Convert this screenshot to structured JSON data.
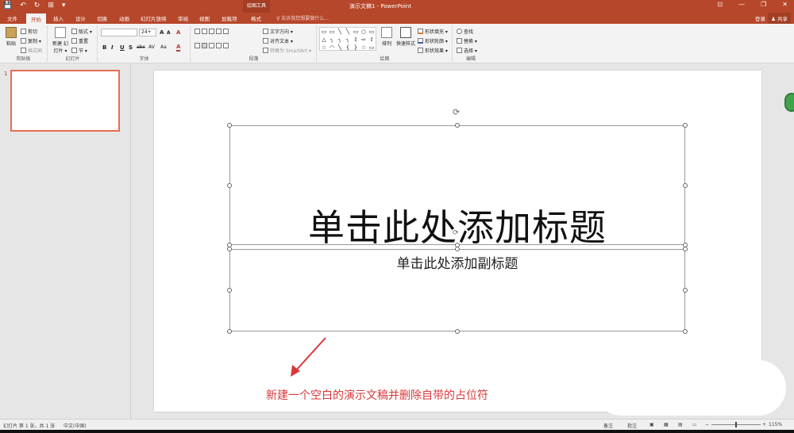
{
  "app": {
    "title": "演示文稿1 - PowerPoint",
    "context_tab_group": "绘图工具",
    "qat": [
      "💾",
      "↶",
      "↻",
      "⊞",
      "▾"
    ],
    "window_buttons": [
      "⊡",
      "—",
      "❐",
      "✕"
    ]
  },
  "tabs": {
    "file": "文件",
    "home": "开始",
    "insert": "插入",
    "design": "设计",
    "transitions": "切换",
    "animations": "动画",
    "slideshow": "幻灯片放映",
    "review": "审阅",
    "view": "视图",
    "addins": "加载项",
    "format": "格式"
  },
  "tell_me": "♀ 告诉我您想要做什么...",
  "login": "登录",
  "share": "♟ 共享",
  "ribbon": {
    "clipboard": {
      "paste": "粘贴",
      "cut": "剪切",
      "copy": "复制 ▾",
      "format_painter": "格式刷",
      "label": "剪贴板"
    },
    "slides": {
      "new_slide": "新建\n幻灯片 ▾",
      "layout": "版式 ▾",
      "reset": "重置",
      "section": "节 ▾",
      "label": "幻灯片"
    },
    "font": {
      "font_name": "",
      "font_size": "24+",
      "grow": "A",
      "shrink": "A",
      "clear": "A",
      "bold": "B",
      "italic": "I",
      "underline": "U",
      "shadow": "S",
      "strike": "abc",
      "spacing": "AV",
      "case": "Aa",
      "color": "A",
      "label": "字体"
    },
    "paragraph": {
      "text_direction": "文字方向 ▾",
      "align_text": "对齐文本 ▾",
      "smartart": "转换为 SmartArt ▾",
      "label": "段落"
    },
    "drawing": {
      "arrange": "排列",
      "quick_styles": "快速样式",
      "fill": "形状填充 ▾",
      "outline": "形状轮廓 ▾",
      "effects": "形状效果 ▾",
      "label": "绘图"
    },
    "editing": {
      "find": "查找",
      "replace": "替换 ▾",
      "select": "选择 ▾",
      "label": "编辑"
    }
  },
  "shapes_gallery": [
    "▭",
    "▭",
    "╲",
    "╲",
    "▭",
    "○",
    "▭",
    "△",
    "╮",
    "╮",
    "╮",
    "⇩",
    "⇨",
    "⇧",
    "☆",
    "◠",
    "╲",
    "{",
    "}",
    "☆",
    "▭"
  ],
  "slide_panel": {
    "number": "1"
  },
  "slide": {
    "title_placeholder": "单击此处添加标题",
    "subtitle_placeholder": "单击此处添加副标题"
  },
  "annotation": {
    "text": "新建一个空白的演示文稿并删除自带的占位符",
    "color": "#d9383a"
  },
  "status": {
    "slide_info": "幻灯片 第 1 张，共 1 张",
    "language": "中文(中国)",
    "notes": "备注",
    "comments": "批注",
    "zoom": "115%"
  },
  "colors": {
    "accent": "#b7472a",
    "selected_thumb_border": "#e86d4f"
  }
}
